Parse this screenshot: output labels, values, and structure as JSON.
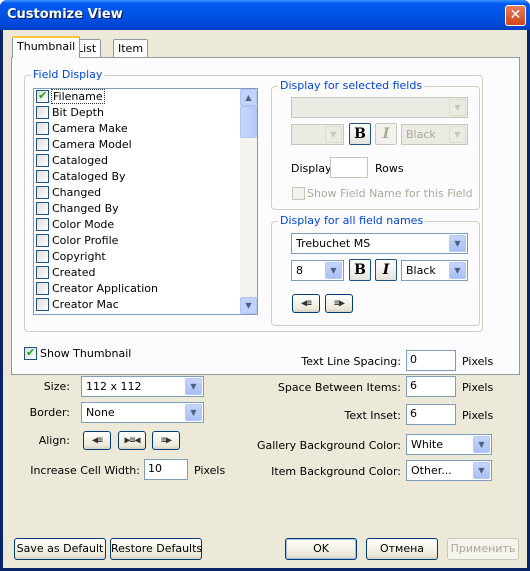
{
  "window": {
    "title": "Customize View",
    "close_symbol": "✕"
  },
  "tabs": [
    {
      "label": "Thumbnail",
      "active": true
    },
    {
      "label": "List",
      "active": false
    },
    {
      "label": "Item",
      "active": false
    }
  ],
  "field_display": {
    "label": "Field Display",
    "items": [
      {
        "label": "Filename",
        "checked": true,
        "selected": true
      },
      {
        "label": "Bit Depth",
        "checked": false
      },
      {
        "label": "Camera Make",
        "checked": false
      },
      {
        "label": "Camera Model",
        "checked": false
      },
      {
        "label": "Cataloged",
        "checked": false
      },
      {
        "label": "Cataloged By",
        "checked": false
      },
      {
        "label": "Changed",
        "checked": false
      },
      {
        "label": "Changed By",
        "checked": false
      },
      {
        "label": "Color Mode",
        "checked": false
      },
      {
        "label": "Color Profile",
        "checked": false
      },
      {
        "label": "Copyright",
        "checked": false
      },
      {
        "label": "Created",
        "checked": false
      },
      {
        "label": "Creator Application",
        "checked": false
      },
      {
        "label": "Creator Mac",
        "checked": false
      }
    ]
  },
  "selected_fields": {
    "label": "Display for selected fields",
    "font_value": "",
    "size_value": "",
    "bold_label": "B",
    "italic_label": "I",
    "color_value": "Black",
    "display_label": "Display",
    "rows_value": "",
    "rows_label": "Rows",
    "show_field_name_label": "Show Field Name for this Field"
  },
  "all_fields": {
    "label": "Display for all field names",
    "font_value": "Trebuchet MS",
    "size_value": "8",
    "bold_label": "B",
    "italic_label": "I",
    "color_value": "Black"
  },
  "thumbnail": {
    "show_label": "Show Thumbnail",
    "show_checked": true,
    "size_label": "Size:",
    "size_value": "112 x 112",
    "border_label": "Border:",
    "border_value": "None",
    "align_label": "Align:",
    "cell_width_label": "Increase Cell Width:",
    "cell_width_value": "10",
    "cell_width_unit": "Pixels"
  },
  "spacing": {
    "text_line_label": "Text Line Spacing:",
    "text_line_value": "0",
    "space_between_label": "Space Between Items:",
    "space_between_value": "6",
    "text_inset_label": "Text Inset:",
    "text_inset_value": "6",
    "unit": "Pixels",
    "gallery_bg_label": "Gallery Background Color:",
    "gallery_bg_value": "White",
    "item_bg_label": "Item Background Color:",
    "item_bg_value": "Other..."
  },
  "buttons": {
    "save_default": "Save as Default",
    "restore_defaults": "Restore Defaults",
    "ok": "OK",
    "cancel": "Отмена",
    "apply": "Применить"
  },
  "icons": {
    "dropdown": "▼",
    "scroll_up": "▲",
    "scroll_down": "▼",
    "align_left": "◀≡",
    "align_center": "▶≡◀",
    "align_right": "≡▶"
  },
  "colors": {
    "title_bar": "#0054e3",
    "face": "#ece9d8",
    "group_label": "#0046d5",
    "border": "#7f9db9"
  }
}
